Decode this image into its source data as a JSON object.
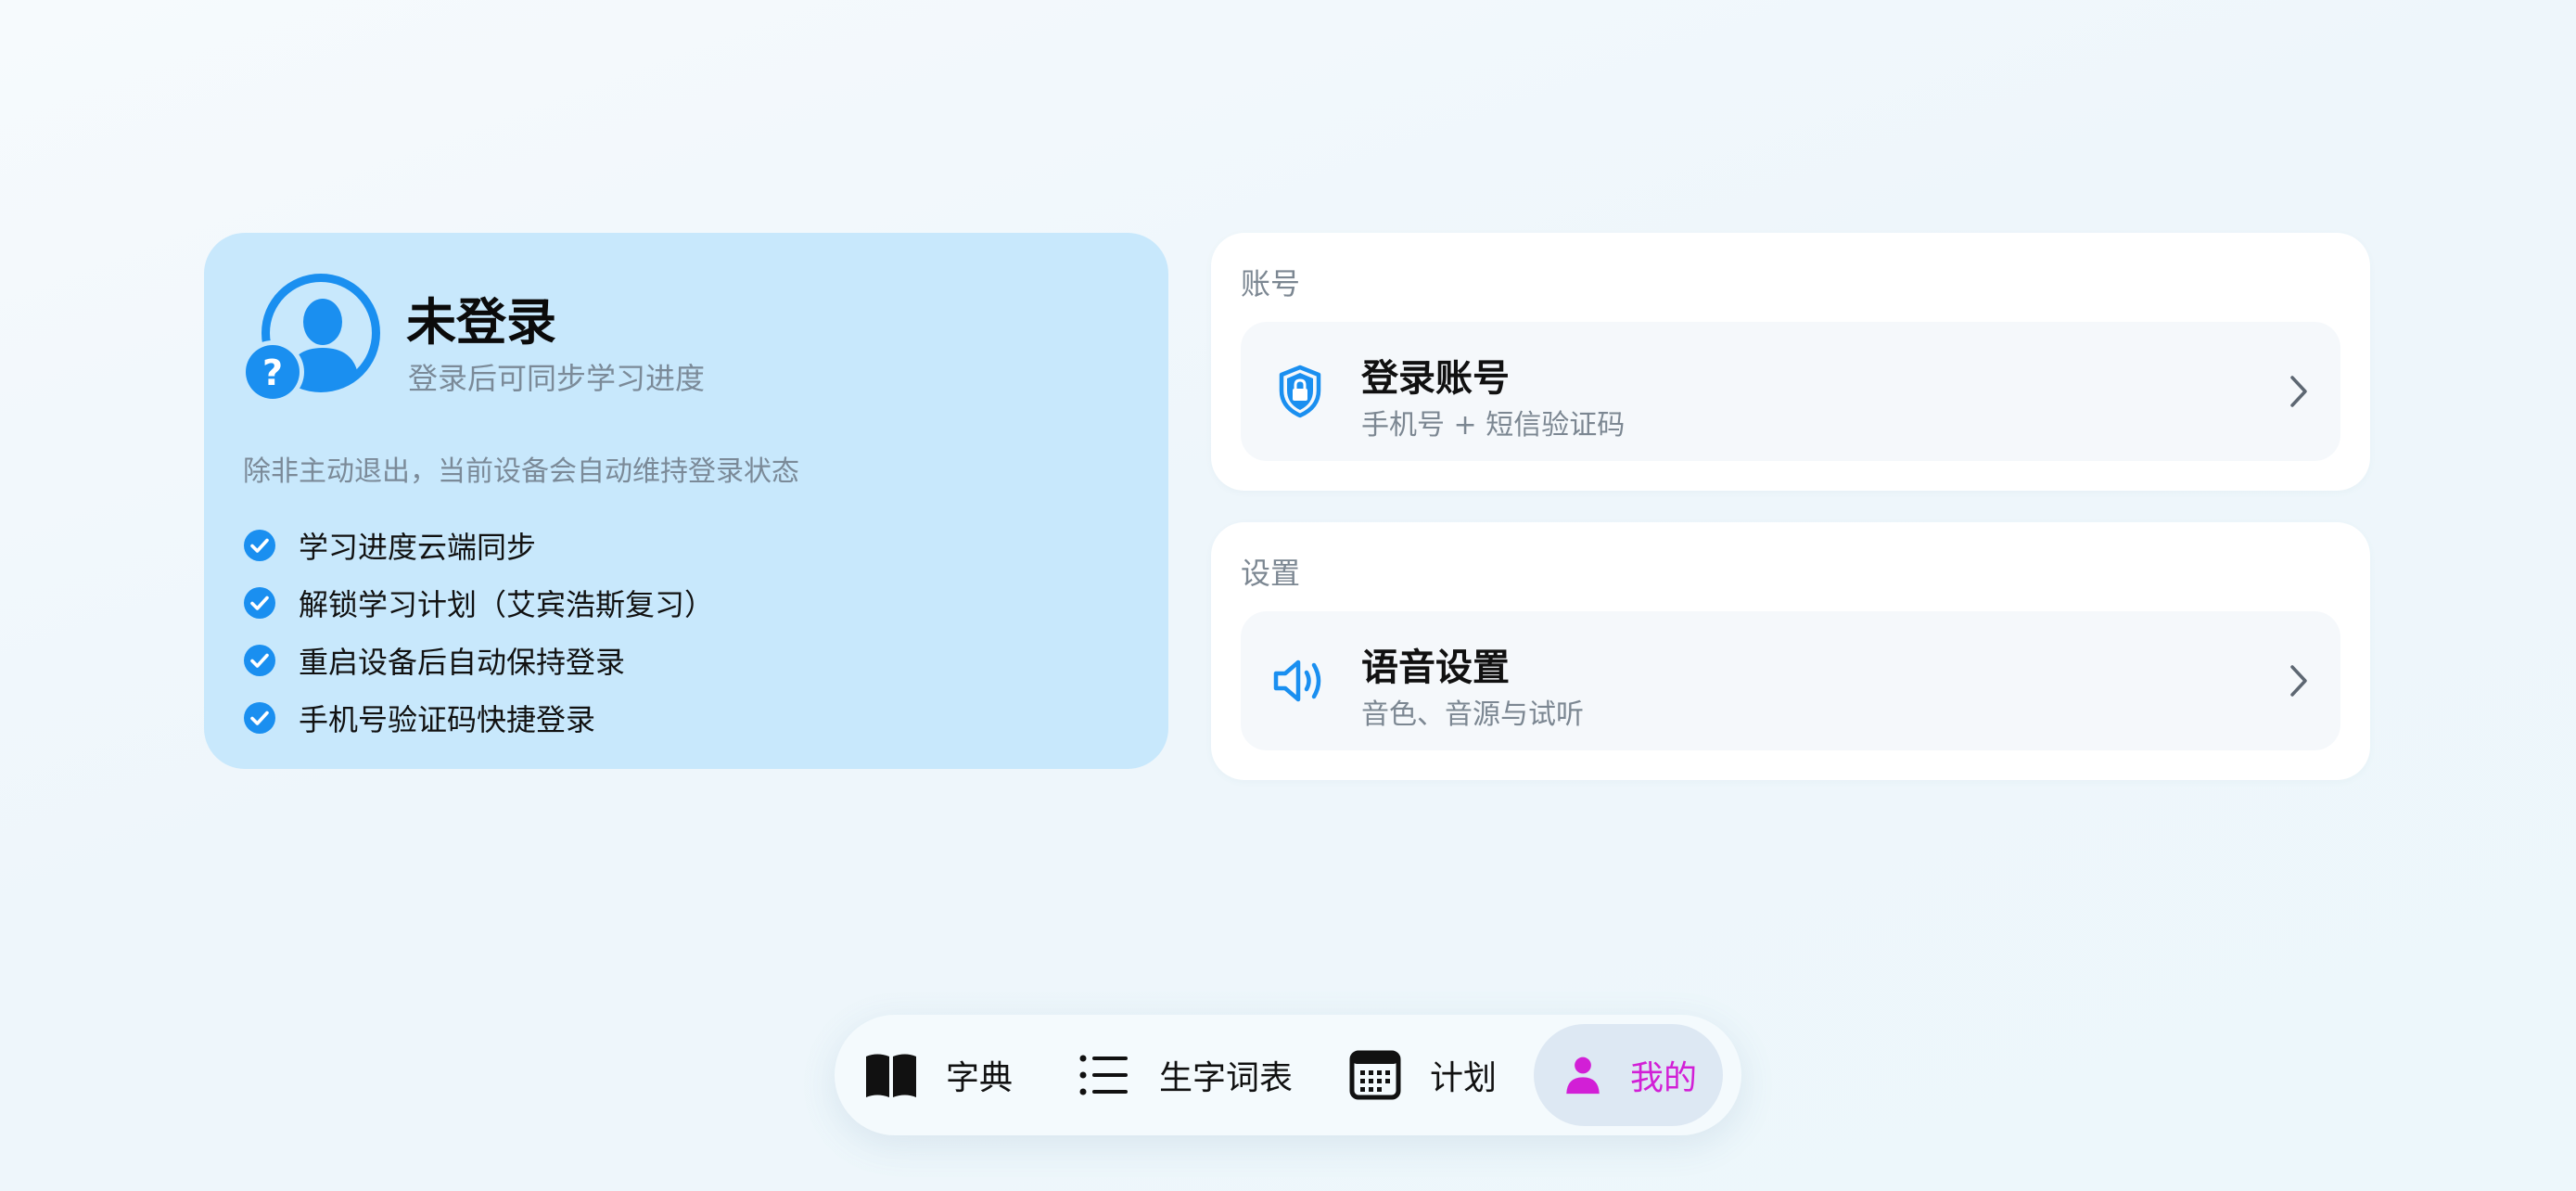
{
  "profile": {
    "title": "未登录",
    "subtitle": "登录后可同步学习进度",
    "note": "除非主动退出，当前设备会自动维持登录状态",
    "features": [
      "学习进度云端同步",
      "解锁学习计划（艾宾浩斯复习）",
      "重启设备后自动保持登录",
      "手机号验证码快捷登录"
    ],
    "avatar_icon": "user-question-icon"
  },
  "sections": {
    "account": {
      "header": "账号",
      "row": {
        "icon": "shield-lock-icon",
        "title": "登录账号",
        "subtitle": "手机号 + 短信验证码"
      }
    },
    "settings": {
      "header": "设置",
      "row": {
        "icon": "speaker-icon",
        "title": "语音设置",
        "subtitle": "音色、音源与试听"
      }
    }
  },
  "tabbar": {
    "tabs": [
      {
        "label": "字典",
        "icon": "open-book-icon",
        "selected": false
      },
      {
        "label": "生字词表",
        "icon": "list-icon",
        "selected": false
      },
      {
        "label": "计划",
        "icon": "calendar-icon",
        "selected": false
      },
      {
        "label": "我的",
        "icon": "person-icon",
        "selected": true
      }
    ]
  },
  "colors": {
    "accent_blue": "#1a8ff0",
    "selected_tab": "#d21fd6",
    "profile_card": "#c8e8fc"
  }
}
